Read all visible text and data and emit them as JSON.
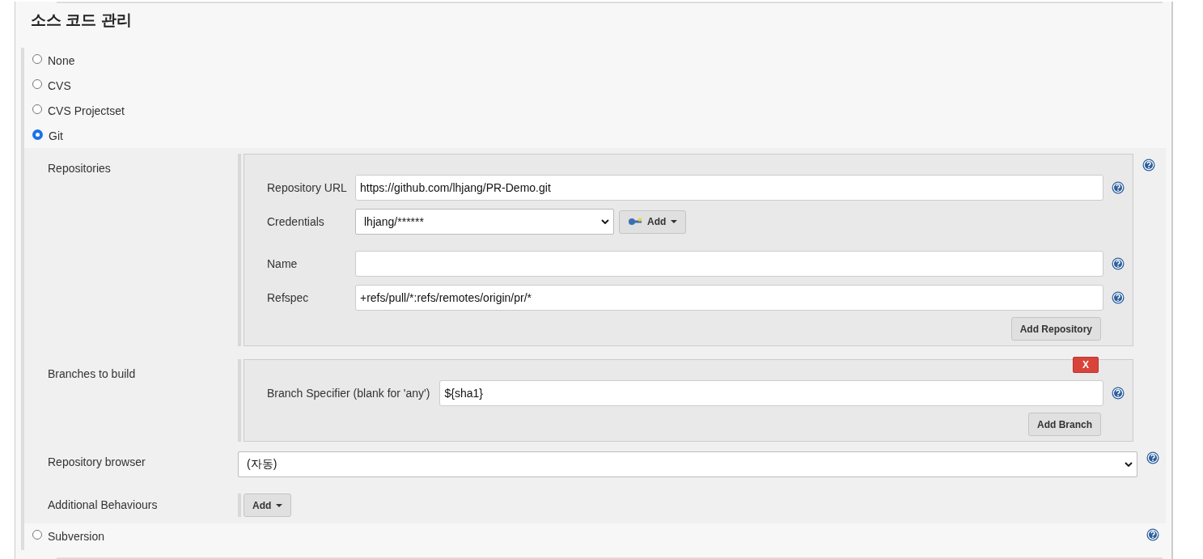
{
  "title": "소스 코드 관리",
  "options": [
    {
      "label": "None",
      "selected": false,
      "help": false
    },
    {
      "label": "CVS",
      "selected": false,
      "help": false
    },
    {
      "label": "CVS Projectset",
      "selected": false,
      "help": false
    },
    {
      "label": "Git",
      "selected": true,
      "help": false,
      "config": {
        "repositories": {
          "label": "Repositories",
          "fields": [
            {
              "kind": "text",
              "label": "Repository URL",
              "value": "https://github.com/lhjang/PR-Demo.git"
            },
            {
              "kind": "credentials",
              "label": "Credentials",
              "value": "lhjang/******",
              "button": "Add"
            },
            {
              "kind": "text",
              "label": "Name"
            },
            {
              "kind": "text",
              "label": "Refspec",
              "value": "+refs/pull/*:refs/remotes/origin/pr/*"
            }
          ],
          "add_button": "Add Repository"
        },
        "branches": {
          "label": "Branches to build",
          "delete_button": "X",
          "fields": [
            {
              "kind": "text",
              "label": "Branch Specifier (blank for 'any')",
              "value": "${sha1}"
            }
          ],
          "add_button": "Add Branch"
        },
        "repository_browser": {
          "label": "Repository browser",
          "value": "(자동)"
        },
        "additional_behaviours": {
          "label": "Additional Behaviours",
          "button": "Add"
        }
      }
    },
    {
      "label": "Subversion",
      "selected": false,
      "help": true
    }
  ]
}
